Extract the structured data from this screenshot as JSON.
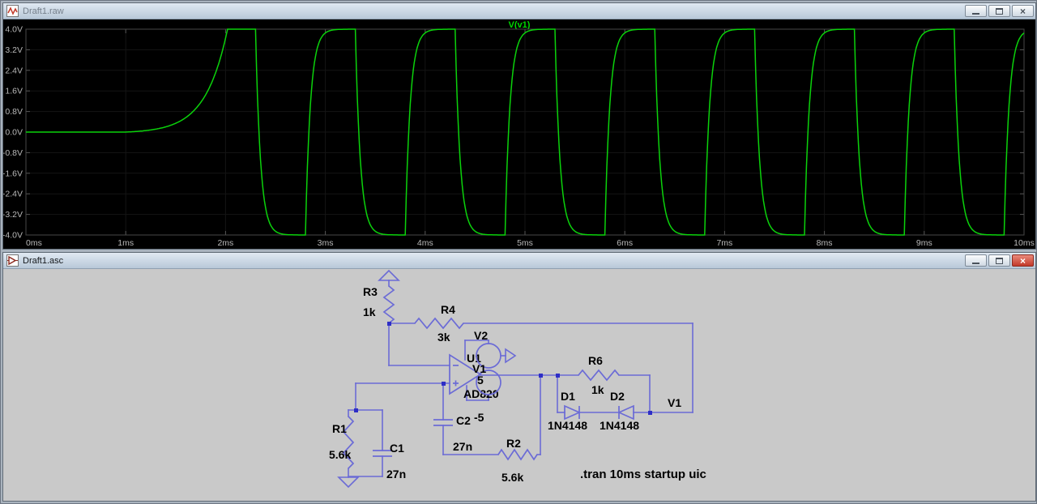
{
  "waveform_window": {
    "title": "Draft1.raw"
  },
  "schematic_window": {
    "title": "Draft1.asc"
  },
  "chart_data": {
    "type": "line",
    "title": "V(v1)",
    "title_color": "#00d800",
    "trace_color": "#0bd20b",
    "background": "#000000",
    "series": [
      {
        "name": "V(v1)",
        "color": "#0bd20b"
      }
    ],
    "x_ticks": [
      "0ms",
      "1ms",
      "2ms",
      "3ms",
      "4ms",
      "5ms",
      "6ms",
      "7ms",
      "8ms",
      "9ms",
      "10ms"
    ],
    "x_range_ms": [
      0,
      10
    ],
    "y_ticks": [
      "4.0V",
      "3.2V",
      "2.4V",
      "1.6V",
      "0.8V",
      "0.0V",
      "-0.8V",
      "-1.6V",
      "-2.4V",
      "-3.2V",
      "-4.0V"
    ],
    "y_range_v": [
      -4,
      4
    ],
    "grid": false,
    "legend_position": "top-center",
    "signal": {
      "description": "Oscillator startup: 0V until ~1ms, exponential growth to +4V rail at ~2ms, then ±4V square wave with ~1ms period",
      "flat_until_ms": 1.0,
      "startup_rail_hit_ms": 2.02,
      "startup_tau_ms": 0.22,
      "rail_v": 4,
      "edges_ms": [
        2.3,
        2.8,
        3.3,
        3.8,
        4.3,
        4.8,
        5.3,
        5.8,
        6.3,
        6.8,
        7.3,
        7.8,
        8.3,
        8.8,
        9.3,
        9.8
      ],
      "edge_tau_ms": 0.05
    }
  },
  "schematic": {
    "directive": ".tran 10ms startup uic",
    "net_label": "V1",
    "labels": {
      "R1": {
        "name": "R1",
        "value": "5.6k"
      },
      "R2": {
        "name": "R2",
        "value": "5.6k"
      },
      "R3": {
        "name": "R3",
        "value": "1k"
      },
      "R4": {
        "name": "R4",
        "value": "3k"
      },
      "R6": {
        "name": "R6",
        "value": "1k"
      },
      "C1": {
        "name": "C1",
        "value": "27n"
      },
      "C2": {
        "name": "C2",
        "value": "27n"
      },
      "D1": {
        "name": "D1",
        "value": "1N4148"
      },
      "D2": {
        "name": "D2",
        "value": "1N4148"
      },
      "U1": {
        "name": "U1",
        "value": "AD820"
      },
      "V2": {
        "name": "V2"
      },
      "V1_source": {
        "name": "V1",
        "value_top": "5",
        "value_bottom": "-5"
      }
    }
  }
}
